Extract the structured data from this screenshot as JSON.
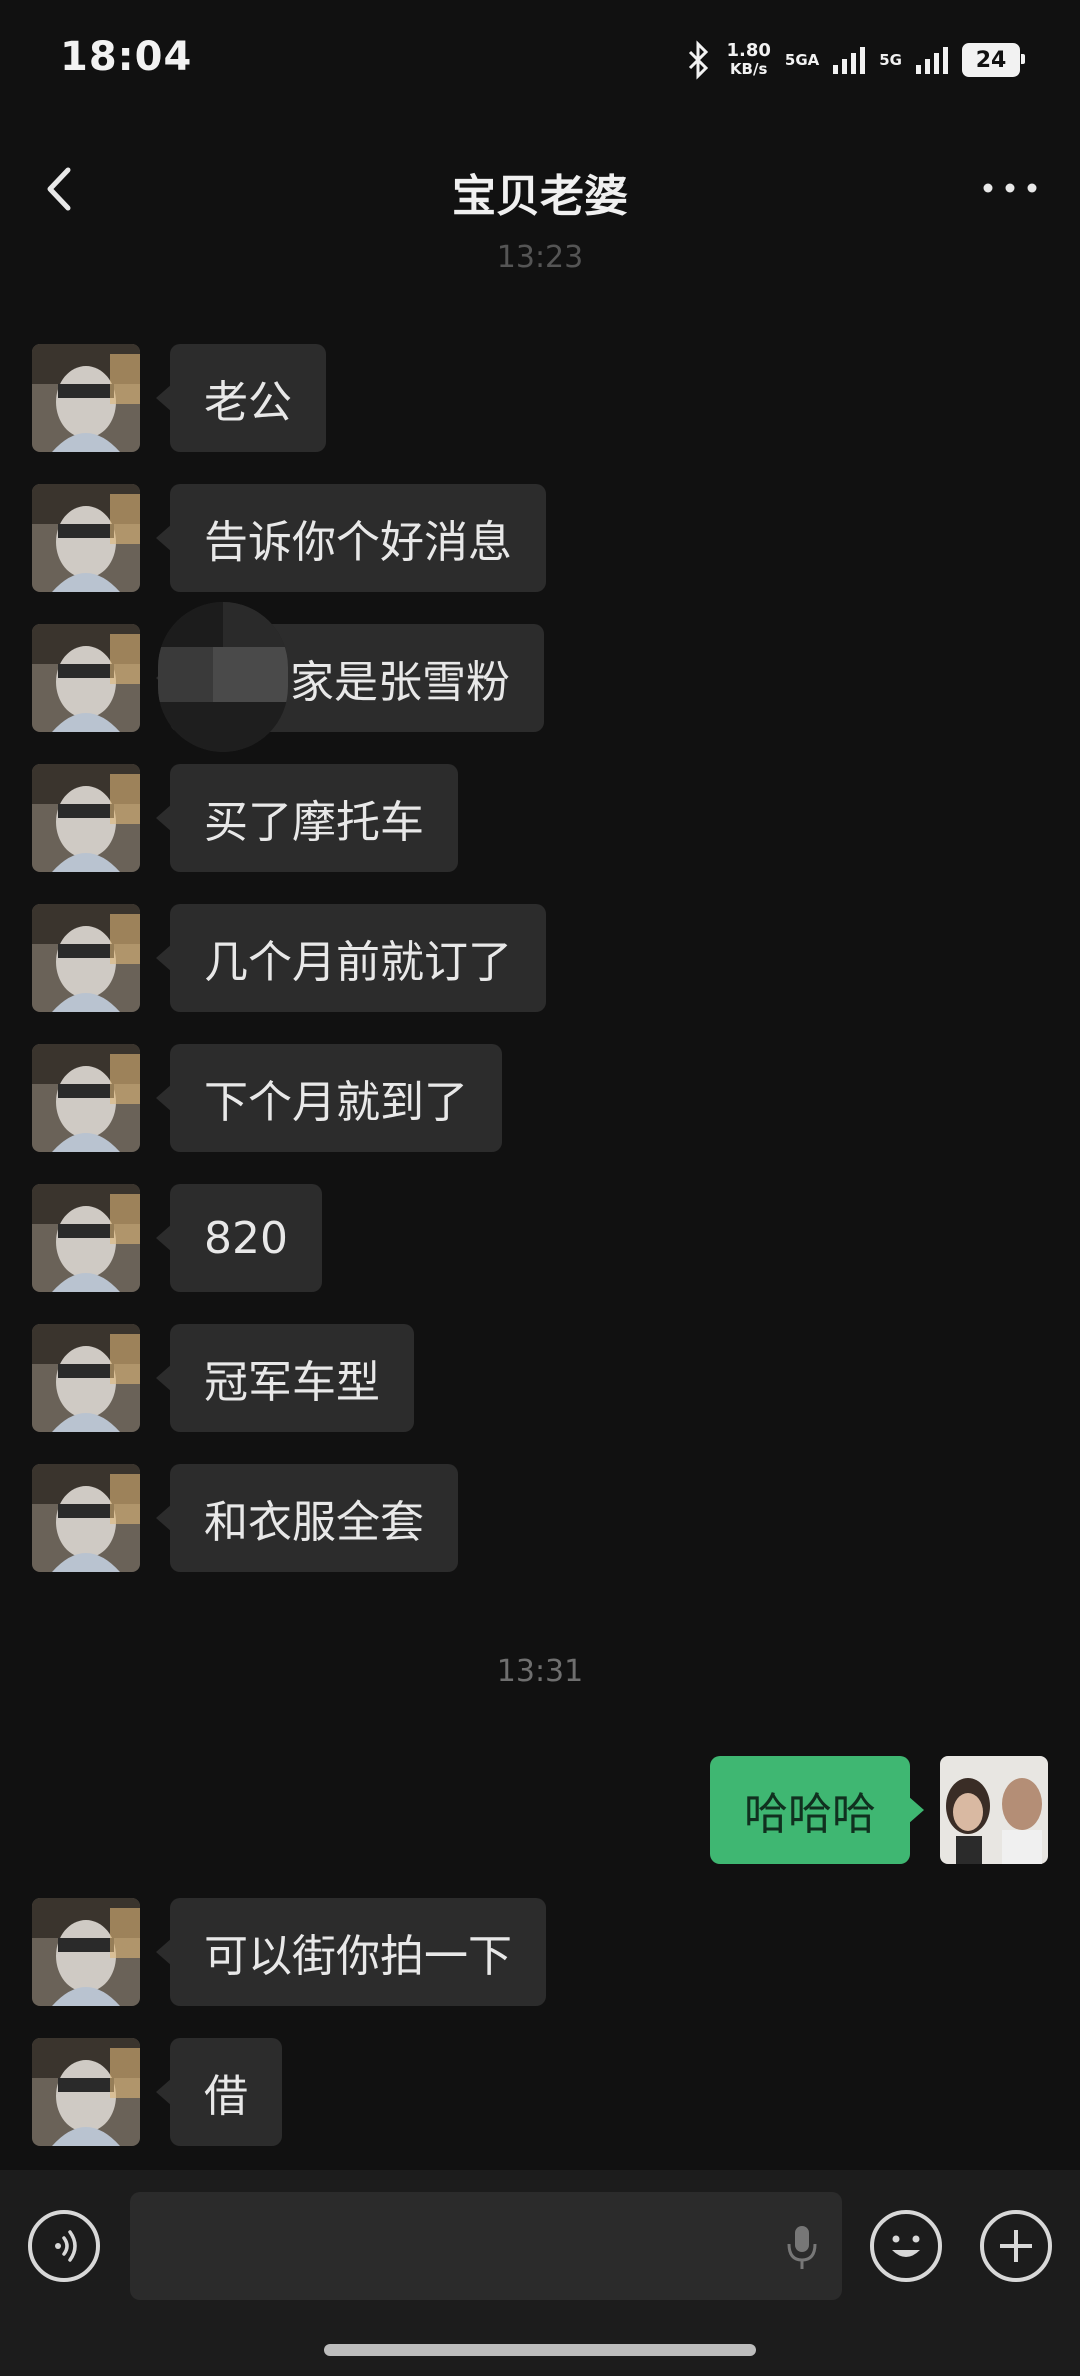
{
  "status": {
    "time": "18:04",
    "speed_value": "1.80",
    "speed_unit": "KB/s",
    "net1": "5GA",
    "net2": "5G",
    "battery": "24"
  },
  "header": {
    "title": "宝贝老婆"
  },
  "timestamps": [
    "13:23",
    "13:31"
  ],
  "messages": [
    {
      "side": "in",
      "text": "老公"
    },
    {
      "side": "in",
      "text": "告诉你个好消息"
    },
    {
      "side": "in",
      "text": "家是张雪粉"
    },
    {
      "side": "in",
      "text": "买了摩托车"
    },
    {
      "side": "in",
      "text": "几个月前就订了"
    },
    {
      "side": "in",
      "text": "下个月就到了"
    },
    {
      "side": "in",
      "text": "820"
    },
    {
      "side": "in",
      "text": "冠军车型"
    },
    {
      "side": "in",
      "text": "和衣服全套"
    },
    {
      "side": "out",
      "text": "哈哈哈"
    },
    {
      "side": "in",
      "text": "可以街你拍一下"
    },
    {
      "side": "in",
      "text": "借"
    }
  ],
  "colors": {
    "background": "#111111",
    "incoming_bubble": "#2c2c2c",
    "outgoing_bubble": "#3fb772"
  },
  "icons": {
    "back": "chevron-left-icon",
    "more": "more-dots-icon",
    "voice": "voice-icon",
    "mic": "mic-icon",
    "emoji": "emoji-icon",
    "plus": "plus-icon"
  }
}
